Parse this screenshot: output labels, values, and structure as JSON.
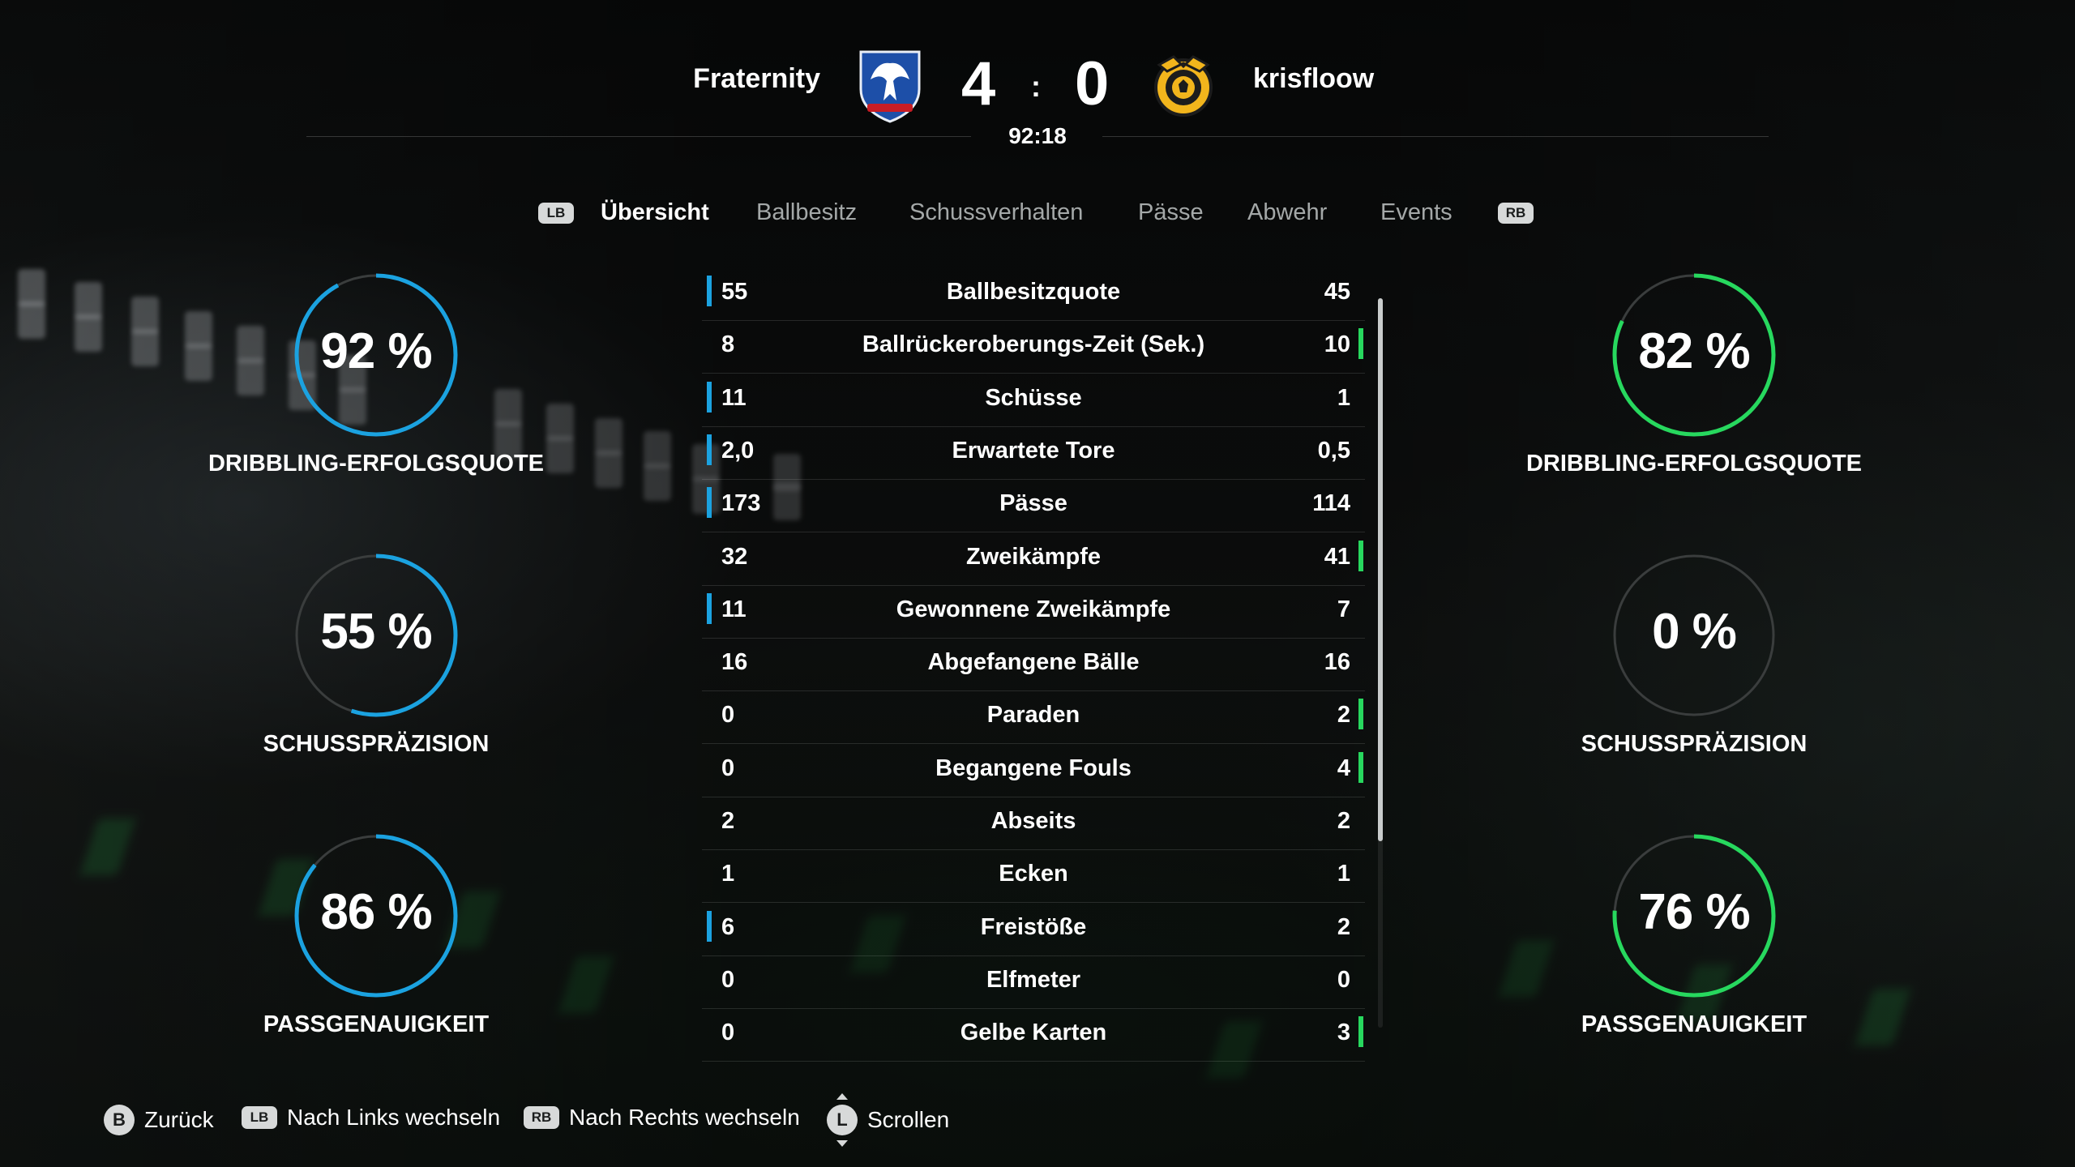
{
  "match": {
    "home_team": "Fraternity",
    "away_team": "krisfloow",
    "home_score": "4",
    "away_score": "0",
    "separator": ":",
    "clock": "92:18",
    "home_crest": "eagle-crest-icon",
    "away_crest": "badge-crest-icon"
  },
  "tabs": {
    "left_button": "LB",
    "right_button": "RB",
    "items": [
      "Übersicht",
      "Ballbesitz",
      "Schussverhalten",
      "Pässe",
      "Abwehr",
      "Events"
    ],
    "active": "Übersicht"
  },
  "gauges": {
    "home": [
      {
        "value_text": "92 %",
        "percent": 92,
        "label": "DRIBBLING-ERFOLGSQUOTE"
      },
      {
        "value_text": "55 %",
        "percent": 55,
        "label": "SCHUSSPRÄZISION"
      },
      {
        "value_text": "86 %",
        "percent": 86,
        "label": "PASSGENAUIGKEIT"
      }
    ],
    "away": [
      {
        "value_text": "82 %",
        "percent": 82,
        "label": "DRIBBLING-ERFOLGSQUOTE"
      },
      {
        "value_text": "0 %",
        "percent": 0,
        "label": "SCHUSSPRÄZISION"
      },
      {
        "value_text": "76 %",
        "percent": 76,
        "label": "PASSGENAUIGKEIT"
      }
    ]
  },
  "stats": [
    {
      "home": "55",
      "name": "Ballbesitzquote",
      "away": "45",
      "lead": "home"
    },
    {
      "home": "8",
      "name": "Ballrückeroberungs-Zeit (Sek.)",
      "away": "10",
      "lead": "away"
    },
    {
      "home": "11",
      "name": "Schüsse",
      "away": "1",
      "lead": "home"
    },
    {
      "home": "2,0",
      "name": "Erwartete Tore",
      "away": "0,5",
      "lead": "home"
    },
    {
      "home": "173",
      "name": "Pässe",
      "away": "114",
      "lead": "home"
    },
    {
      "home": "32",
      "name": "Zweikämpfe",
      "away": "41",
      "lead": "away"
    },
    {
      "home": "11",
      "name": "Gewonnene Zweikämpfe",
      "away": "7",
      "lead": "home"
    },
    {
      "home": "16",
      "name": "Abgefangene Bälle",
      "away": "16",
      "lead": "none"
    },
    {
      "home": "0",
      "name": "Paraden",
      "away": "2",
      "lead": "away"
    },
    {
      "home": "0",
      "name": "Begangene Fouls",
      "away": "4",
      "lead": "away"
    },
    {
      "home": "2",
      "name": "Abseits",
      "away": "2",
      "lead": "none"
    },
    {
      "home": "1",
      "name": "Ecken",
      "away": "1",
      "lead": "none"
    },
    {
      "home": "6",
      "name": "Freistöße",
      "away": "2",
      "lead": "home"
    },
    {
      "home": "0",
      "name": "Elfmeter",
      "away": "0",
      "lead": "none"
    },
    {
      "home": "0",
      "name": "Gelbe Karten",
      "away": "3",
      "lead": "away"
    }
  ],
  "footer": {
    "back_button": "B",
    "back_label": "Zurück",
    "left_button": "LB",
    "left_label": "Nach Links wechseln",
    "right_button": "RB",
    "right_label": "Nach Rechts wechseln",
    "scroll_button": "L",
    "scroll_label": "Scrollen"
  },
  "colors": {
    "home_accent": "#1ba2e0",
    "away_accent": "#27d85e",
    "ring_track": "#3a3d3d"
  }
}
